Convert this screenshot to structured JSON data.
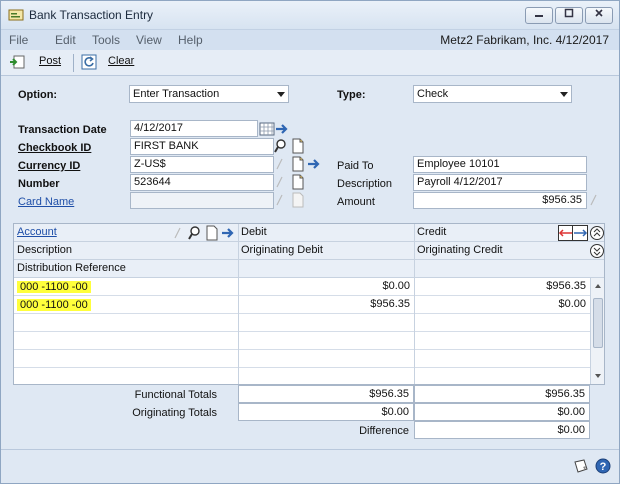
{
  "window": {
    "title": "Bank Transaction Entry"
  },
  "menu": {
    "items": [
      "File",
      "Edit",
      "Tools",
      "View",
      "Help"
    ],
    "company_info": "Metz2  Fabrikam, Inc.  4/12/2017"
  },
  "toolbar": {
    "post_label": "Post",
    "clear_label": "Clear"
  },
  "option": {
    "label": "Option:",
    "value": "Enter Transaction"
  },
  "type": {
    "label": "Type:",
    "value": "Check"
  },
  "header_fields": {
    "transaction_date": {
      "label": "Transaction Date",
      "value": "4/12/2017"
    },
    "checkbook_id": {
      "label": "Checkbook ID",
      "value": "FIRST BANK"
    },
    "currency_id": {
      "label": "Currency ID",
      "value": "Z-US$"
    },
    "number": {
      "label": "Number",
      "value": "523644"
    },
    "card_name": {
      "label": "Card Name",
      "value": ""
    }
  },
  "payee": {
    "paid_to": {
      "label": "Paid To",
      "value": "Employee 10101"
    },
    "description": {
      "label": "Description",
      "value": "Payroll 4/12/2017"
    },
    "amount": {
      "label": "Amount",
      "value": "$956.35"
    }
  },
  "grid": {
    "headers": {
      "account": "Account",
      "debit": "Debit",
      "credit": "Credit",
      "description": "Description",
      "orig_debit": "Originating Debit",
      "orig_credit": "Originating Credit",
      "distribution_reference": "Distribution Reference"
    },
    "rows": [
      {
        "account": "000 -1100 -00",
        "debit": "$0.00",
        "credit": "$956.35"
      },
      {
        "account": "000 -1100 -00",
        "debit": "$956.35",
        "credit": "$0.00"
      }
    ]
  },
  "totals": {
    "functional": {
      "label": "Functional Totals",
      "debit": "$956.35",
      "credit": "$956.35"
    },
    "originating": {
      "label": "Originating Totals",
      "debit": "$0.00",
      "credit": "$0.00"
    },
    "difference": {
      "label": "Difference",
      "value": "$0.00"
    }
  },
  "colors": {
    "highlight": "#ffff3c",
    "link": "#1f4fa8",
    "window_bg": "#dfe8f3"
  }
}
